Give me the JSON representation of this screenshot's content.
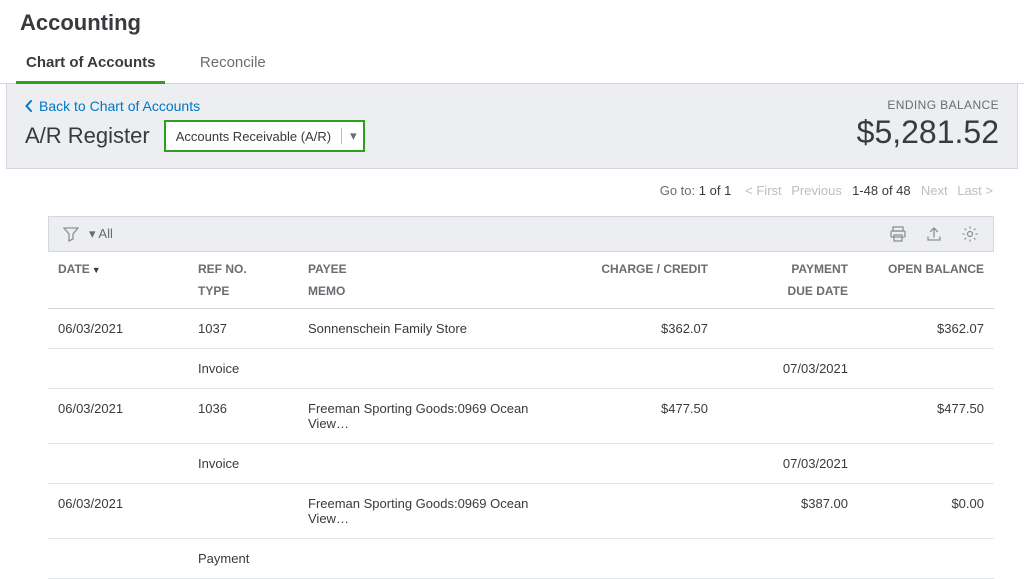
{
  "header": {
    "title": "Accounting"
  },
  "tabs": {
    "chart": "Chart of Accounts",
    "reconcile": "Reconcile"
  },
  "panel": {
    "back": "Back to Chart of Accounts",
    "register_title": "A/R Register",
    "account_selected": "Accounts Receivable (A/R)",
    "ending_label": "ENDING BALANCE",
    "ending_value": "$5,281.52"
  },
  "pager": {
    "goto_label": "Go to:",
    "page": "1",
    "of": "of 1",
    "first": "< First",
    "prev": "Previous",
    "range": "1-48 of 48",
    "next": "Next",
    "last": "Last >"
  },
  "toolbar": {
    "filter_label": "All"
  },
  "columns": {
    "date": "DATE",
    "ref": "REF NO.",
    "type": "TYPE",
    "payee": "PAYEE",
    "memo": "MEMO",
    "charge": "CHARGE / CREDIT",
    "payment": "PAYMENT",
    "due": "DUE DATE",
    "open": "OPEN BALANCE"
  },
  "rows": [
    {
      "date": "06/03/2021",
      "ref": "1037",
      "payee": "Sonnenschein Family Store",
      "charge": "$362.07",
      "payment": "",
      "open": "$362.07",
      "type": "Invoice",
      "memo": "",
      "due": "07/03/2021"
    },
    {
      "date": "06/03/2021",
      "ref": "1036",
      "payee": "Freeman Sporting Goods:0969 Ocean View…",
      "charge": "$477.50",
      "payment": "",
      "open": "$477.50",
      "type": "Invoice",
      "memo": "",
      "due": "07/03/2021"
    },
    {
      "date": "06/03/2021",
      "ref": "",
      "payee": "Freeman Sporting Goods:0969 Ocean View…",
      "charge": "",
      "payment": "$387.00",
      "open": "$0.00",
      "type": "Payment",
      "memo": "",
      "due": ""
    }
  ]
}
